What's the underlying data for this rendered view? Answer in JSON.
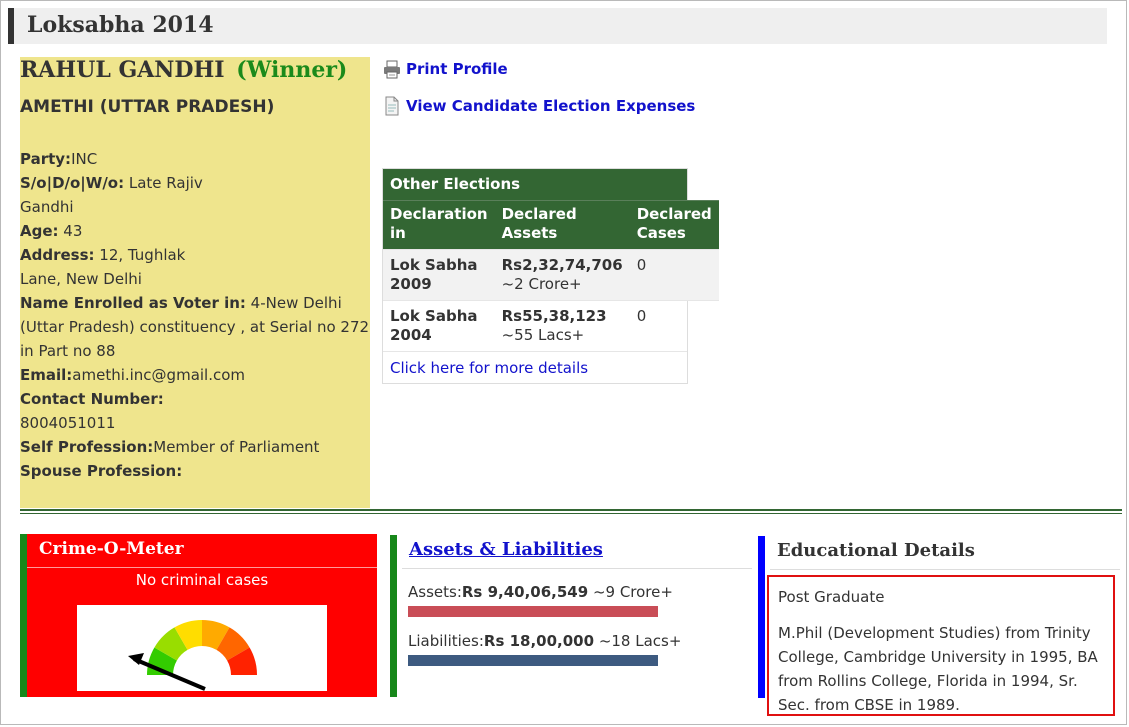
{
  "section_title": "Loksabha 2014",
  "candidate": {
    "name": "RAHUL GANDHI",
    "status": "(Winner)",
    "constituency": "AMETHI (UTTAR PRADESH)",
    "details": [
      {
        "label": "Party:",
        "value": "INC"
      },
      {
        "label": "S/o|D/o|W/o:",
        "value": " Late Rajiv Gandhi"
      },
      {
        "label": "Age:",
        "value": " 43"
      },
      {
        "label": "Address:",
        "value": " 12, Tughlak Lane, New Delhi"
      },
      {
        "label": "Name Enrolled as Voter in:",
        "value": " 4-New Delhi (Uttar Pradesh) constituency , at Serial no 272 in Part no 88"
      },
      {
        "label": "Email:",
        "value": "amethi.inc@gmail.com"
      },
      {
        "label": "Contact Number:",
        "value": " 8004051011"
      },
      {
        "label": "Self Profession:",
        "value": "Member of Parliament"
      },
      {
        "label": "Spouse Profession:",
        "value": ""
      }
    ]
  },
  "links": {
    "print_profile": "Print Profile",
    "election_expenses": "View Candidate Election Expenses",
    "print_icon": "printer-icon",
    "expenses_icon": "document-icon"
  },
  "other_elections": {
    "title": "Other Elections",
    "headers": [
      "Declaration in",
      "Declared Assets",
      "Declared Cases"
    ],
    "rows": [
      {
        "election": "Lok Sabha 2009",
        "assets": "Rs2,32,74,706",
        "assets_approx": "~2 Crore+",
        "cases": "0"
      },
      {
        "election": "Lok Sabha 2004",
        "assets": "Rs55,38,123",
        "assets_approx": "~55 Lacs+",
        "cases": "0"
      }
    ],
    "more_link": "Click here for more details"
  },
  "crime_meter": {
    "title": "Crime-O-Meter",
    "status": "No criminal cases",
    "gauge_icon": "gauge-icon"
  },
  "assets_liabilities": {
    "title": "Assets & Liabilities",
    "assets_label": "Assets:",
    "assets_value": "Rs 9,40,06,549",
    "assets_approx": " ~9 Crore+",
    "liabilities_label": "Liabilities:",
    "liabilities_value": "Rs 18,00,000",
    "liabilities_approx": " ~18 Lacs+"
  },
  "education": {
    "title": "Educational Details",
    "level": "Post Graduate",
    "description": "M.Phil (Development Studies) from Trinity College, Cambridge University in 1995, BA from Rollins College, Florida in 1994, Sr. Sec. from CBSE in 1989."
  },
  "colors": {
    "profile_bg": "#efe58d",
    "winner": "#1b8a1b",
    "table_head": "#336633",
    "crime_bg": "#ff0000",
    "assets_bar": "#c94d57",
    "liabilities_bar": "#3d5a80",
    "link": "#1212cc",
    "edu_accent": "#0000ff",
    "highlight_border": "#e01010"
  }
}
